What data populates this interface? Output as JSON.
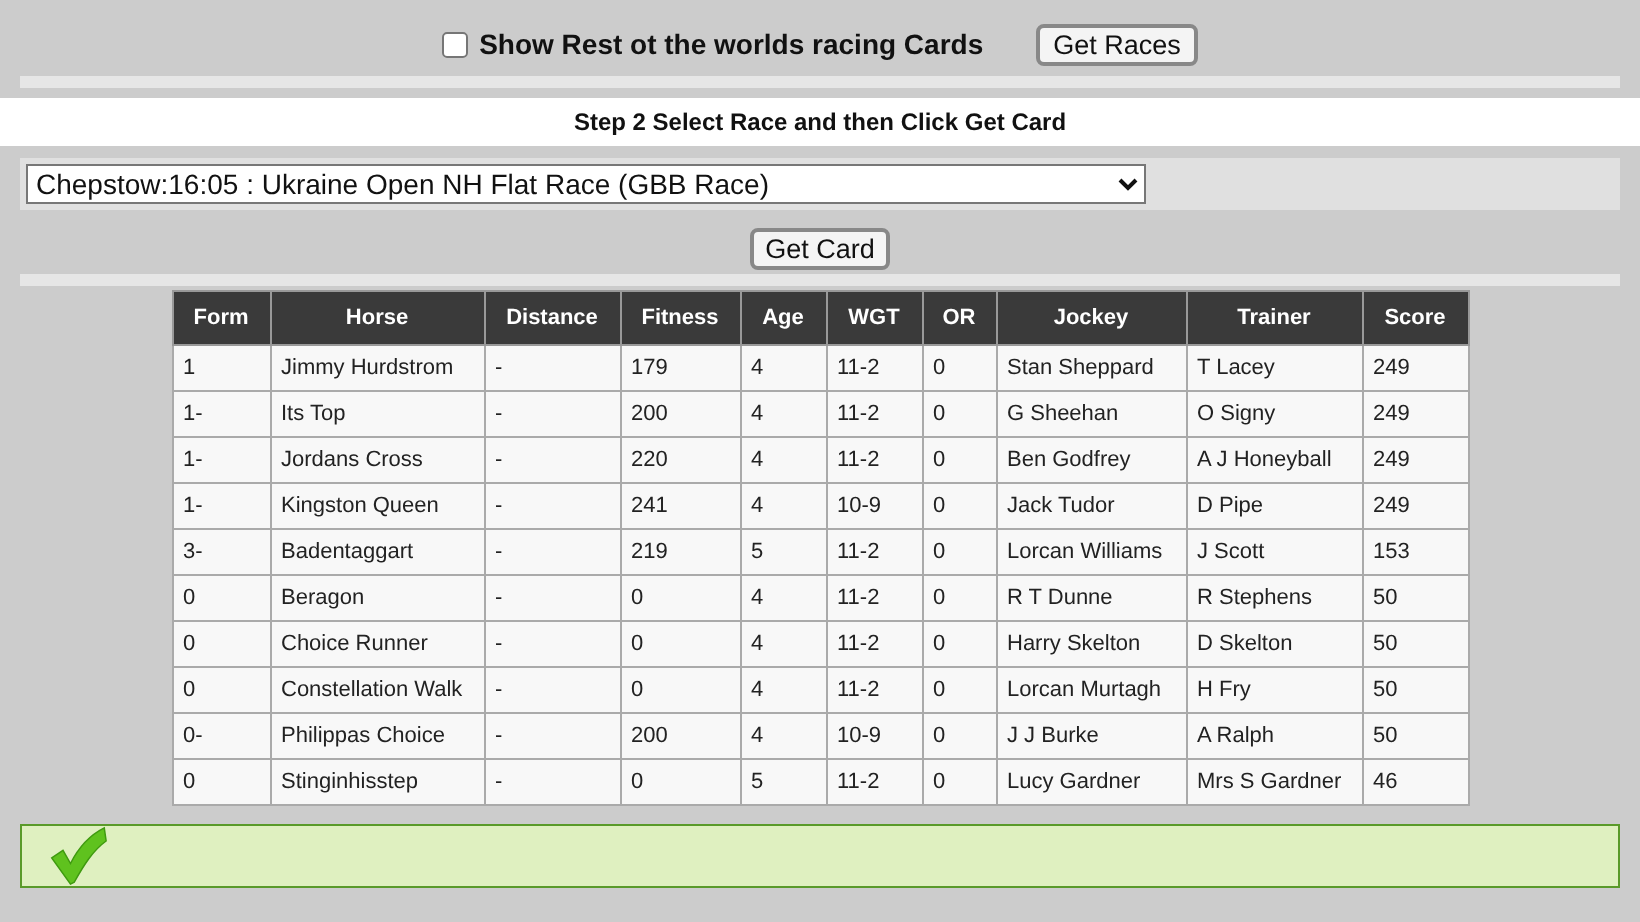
{
  "top": {
    "checkbox": {
      "label": "Show Rest ot the worlds racing Cards",
      "checked": false
    },
    "button": "Get Races"
  },
  "step": "Step 2 Select Race and then Click Get Card",
  "race_select": {
    "value": "Chepstow:16:05 : Ukraine Open NH Flat Race (GBB Race)"
  },
  "get_card_button": "Get Card",
  "table": {
    "columns": [
      "Form",
      "Horse",
      "Distance",
      "Fitness",
      "Age",
      "WGT",
      "OR",
      "Jockey",
      "Trainer",
      "Score"
    ],
    "rows": [
      [
        "1",
        "Jimmy Hurdstrom",
        "-",
        "179",
        "4",
        "11-2",
        "0",
        "Stan Sheppard",
        "T Lacey",
        "249"
      ],
      [
        "1-",
        "Its Top",
        "-",
        "200",
        "4",
        "11-2",
        "0",
        "G Sheehan",
        "O Signy",
        "249"
      ],
      [
        "1-",
        "Jordans Cross",
        "-",
        "220",
        "4",
        "11-2",
        "0",
        "Ben Godfrey",
        "A J Honeyball",
        "249"
      ],
      [
        "1-",
        "Kingston Queen",
        "-",
        "241",
        "4",
        "10-9",
        "0",
        "Jack Tudor",
        "D Pipe",
        "249"
      ],
      [
        "3-",
        "Badentaggart",
        "-",
        "219",
        "5",
        "11-2",
        "0",
        "Lorcan Williams",
        "J Scott",
        "153"
      ],
      [
        "0",
        "Beragon",
        "-",
        "0",
        "4",
        "11-2",
        "0",
        "R T Dunne",
        "R Stephens",
        "50"
      ],
      [
        "0",
        "Choice Runner",
        "-",
        "0",
        "4",
        "11-2",
        "0",
        "Harry Skelton",
        "D Skelton",
        "50"
      ],
      [
        "0",
        "Constellation Walk",
        "-",
        "0",
        "4",
        "11-2",
        "0",
        "Lorcan Murtagh",
        "H Fry",
        "50"
      ],
      [
        "0-",
        "Philippas Choice",
        "-",
        "200",
        "4",
        "10-9",
        "0",
        "J J Burke",
        "A Ralph",
        "50"
      ],
      [
        "0",
        "Stinginhisstep",
        "-",
        "0",
        "5",
        "11-2",
        "0",
        "Lucy Gardner",
        "Mrs S Gardner",
        "46"
      ]
    ]
  },
  "status": {
    "kind": "success"
  }
}
